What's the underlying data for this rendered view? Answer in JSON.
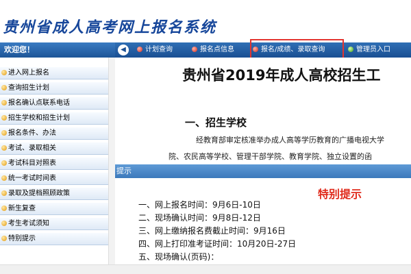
{
  "header": {
    "title": "贵州省成人高考网上报名系统"
  },
  "nav": {
    "welcome": "欢迎您！",
    "arrow_glyph": "◀",
    "items": [
      {
        "label": "计划查询",
        "dot": "red"
      },
      {
        "label": "报名点信息",
        "dot": "red"
      },
      {
        "label": "报名/成绩、录取查询",
        "dot": "red"
      },
      {
        "label": "管理员入口",
        "dot": "green"
      }
    ],
    "highlight_color": "#e3342f"
  },
  "sidebar": {
    "items": [
      {
        "label": "进入网上报名"
      },
      {
        "label": "查询招生计划"
      },
      {
        "label": "报名确认点联系电话"
      },
      {
        "label": "招生学校和招生计划"
      },
      {
        "label": "报名条件、办法"
      },
      {
        "label": "考试、录取相关"
      },
      {
        "label": "考试科目对照表"
      },
      {
        "label": "统一考试时间表"
      },
      {
        "label": "录取及提档照顾政策"
      },
      {
        "label": "新生复查"
      },
      {
        "label": "考生考试须知"
      },
      {
        "label": "特别提示"
      }
    ]
  },
  "main": {
    "title": "贵州省2019年成人高校招生工",
    "section1": "一、招生学校",
    "para1": "经教育部审定核准举办成人高等学历教育的广播电视大学",
    "para2": "院、农民高等学校、管理干部学院、教育学院、独立设置的函",
    "tip_bar": "提示",
    "tip_heading": "特别提示",
    "timeline": [
      "一、网上报名时间：9月6日-10日",
      "二、现场确认时间：9月8日-12日",
      "三、网上缴纳报名费截止时间：9月16日",
      "四、网上打印准考证时间：10月20日-27日",
      "五、现场确认(页码)："
    ]
  },
  "colors": {
    "title_blue": "#16469a",
    "nav_blue": "#1a4f92",
    "tip_red": "#e02a1b"
  }
}
